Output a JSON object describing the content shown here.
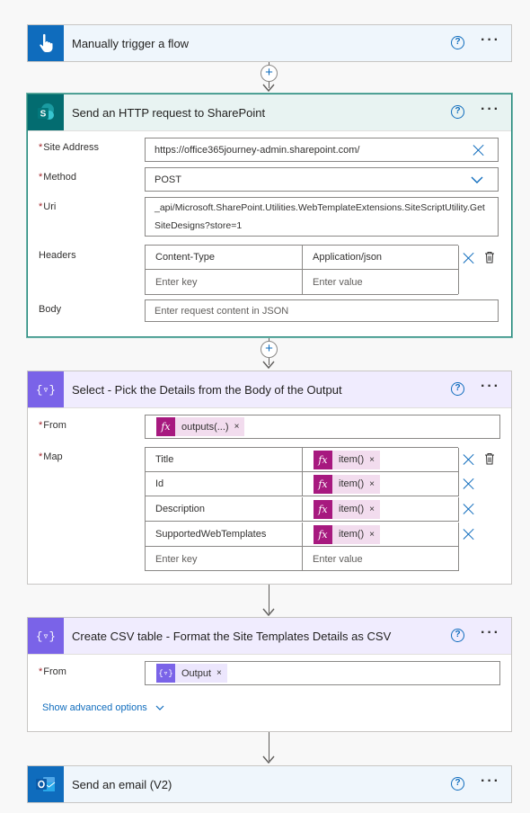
{
  "steps": {
    "trigger": {
      "title": "Manually trigger a flow"
    },
    "http": {
      "title": "Send an HTTP request to SharePoint",
      "site_address_label": "Site Address",
      "site_address_value": "https://office365journey-admin.sharepoint.com/",
      "method_label": "Method",
      "method_value": "POST",
      "uri_label": "Uri",
      "uri_line1": "_api/Microsoft.SharePoint.Utilities.WebTemplateExtensions.SiteScriptUtility.Get",
      "uri_line2": "SiteDesigns?store=1",
      "headers_label": "Headers",
      "header_key": "Content-Type",
      "header_value": "Application/json",
      "key_placeholder": "Enter key",
      "value_placeholder": "Enter value",
      "body_label": "Body",
      "body_placeholder": "Enter request content in JSON"
    },
    "select": {
      "title": "Select - Pick the Details from the Body of the Output",
      "from_label": "From",
      "from_token": "outputs(...)",
      "map_label": "Map",
      "map_rows": [
        {
          "key": "Title",
          "value": "item()"
        },
        {
          "key": "Id",
          "value": "item()"
        },
        {
          "key": "Description",
          "value": "item()"
        },
        {
          "key": "SupportedWebTemplates",
          "value": "item()"
        }
      ],
      "key_placeholder": "Enter key",
      "value_placeholder": "Enter value"
    },
    "csv": {
      "title": "Create CSV table - Format the Site Templates Details as CSV",
      "from_label": "From",
      "from_token": "Output",
      "advanced_label": "Show advanced options"
    },
    "email": {
      "title": "Send an email (V2)"
    }
  },
  "common": {
    "required_mark": "*",
    "help_glyph": "?",
    "more_glyph": "···",
    "fx_glyph": "fx",
    "select_glyph": "{▿}",
    "remove_glyph": "×",
    "plus_glyph": "+"
  },
  "colors": {
    "trigger_accent": "#0f6cbd",
    "sharepoint_accent": "#036c70",
    "select_accent": "#7a63e8",
    "outlook_accent": "#0f6cbd",
    "expression_token": "#a7197f",
    "link": "#0f6cbd"
  },
  "icons": {
    "trigger": "hand-pointer-icon",
    "http": "sharepoint-icon",
    "select": "data-operation-icon",
    "csv": "data-operation-icon",
    "email": "outlook-icon"
  }
}
